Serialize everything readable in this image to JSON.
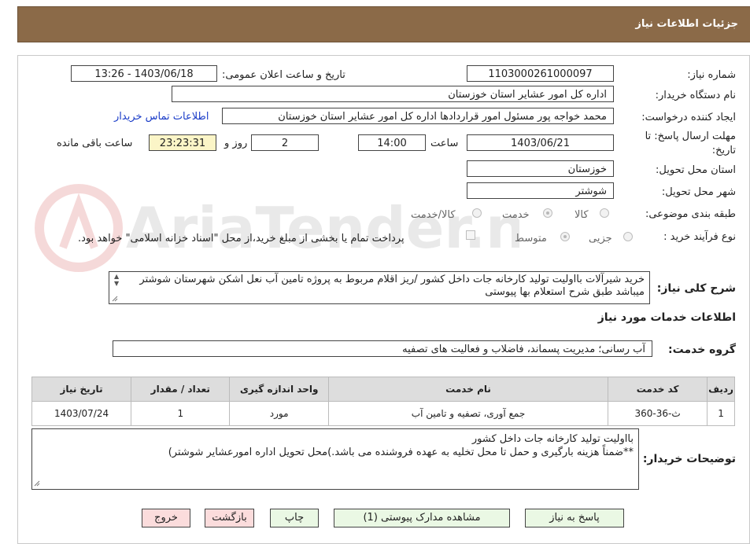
{
  "header": {
    "title": "جزئیات اطلاعات نیاز"
  },
  "fields": {
    "need_number_label": "شماره نیاز:",
    "need_number": "1103000261000097",
    "announce_label": "تاریخ و ساعت اعلان عمومی:",
    "announce_value": "1403/06/18 - 13:26",
    "buyer_label": "نام دستگاه خریدار:",
    "buyer_value": "اداره کل امور عشایر استان خوزستان",
    "creator_label": "ایجاد کننده درخواست:",
    "creator_value": "محمد خواجه پور مسئول امور قراردادها اداره کل امور عشایر استان خوزستان",
    "contact_link": "اطلاعات تماس خریدار",
    "deadline_label_1": "مهلت ارسال پاسخ: تا",
    "deadline_label_2": "تاریخ:",
    "deadline_date": "1403/06/21",
    "time_label": "ساعت",
    "deadline_time": "14:00",
    "days_value": "2",
    "days_label": "روز و",
    "remaining_time": "23:23:31",
    "remaining_label": "ساعت باقی مانده",
    "province_label": "استان محل تحویل:",
    "province_value": "خوزستان",
    "city_label": "شهر محل تحویل:",
    "city_value": "شوشتر",
    "category_label": "طبقه بندی موضوعی:",
    "category_options": [
      "کالا",
      "خدمت",
      "کالا/خدمت"
    ],
    "purchase_type_label": "نوع فرآیند خرید :",
    "purchase_options": [
      "جزیی",
      "متوسط"
    ],
    "payment_note": "پرداخت تمام یا بخشی از مبلغ خرید،از محل \"اسناد خزانه اسلامی\" خواهد بود.",
    "description_label": "شرح کلی نیاز:",
    "description_value": "خرید شیرآلات بااولیت تولید کارخانه جات داخل کشور /ریز اقلام مربوط به پروژه تامین آب نعل اشکن شهرستان شوشتر میباشد طبق شرح استعلام بها پیوستی",
    "services_title": "اطلاعات خدمات مورد نیاز",
    "service_group_label": "گروه خدمت:",
    "service_group_value": "آب رسانی؛ مدیریت پسماند، فاضلاب و فعالیت های تصفیه",
    "buyer_notes_label": "توضیحات خریدار:",
    "buyer_notes_line1": "بااولیت تولید کارخانه جات داخل کشور",
    "buyer_notes_line2": "**ضمناً هزینه بارگیری و حمل تا محل تخلیه به عهده فروشنده می باشد.)محل تحویل اداره امورعشایر شوشتر)"
  },
  "table": {
    "headers": [
      "ردیف",
      "کد خدمت",
      "نام خدمت",
      "واحد اندازه گیری",
      "تعداد / مقدار",
      "تاریخ نیاز"
    ],
    "rows": [
      [
        "1",
        "ث-36-360",
        "جمع آوری، تصفیه و تامین آب",
        "مورد",
        "1",
        "1403/07/24"
      ]
    ]
  },
  "buttons": {
    "reply": "پاسخ به نیاز",
    "attachments": "مشاهده مدارک پیوستی (1)",
    "print": "چاپ",
    "back": "بازگشت",
    "exit": "خروج"
  },
  "watermark": {
    "text": "AriaTender.neT"
  },
  "colors": {
    "header": "#8b6a48",
    "link": "#1a3cc8",
    "yellow": "#fbf5c7",
    "green_button": "#eaf8e4",
    "pink_button": "#fbdcdc"
  }
}
